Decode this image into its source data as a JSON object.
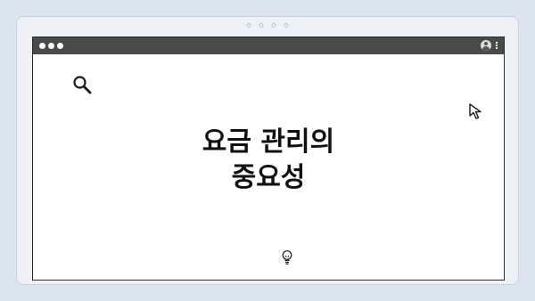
{
  "pager": {
    "dots": [
      "dot-1",
      "dot-2",
      "dot-3",
      "dot-4"
    ]
  },
  "window": {
    "titlebar": {
      "controls": [
        "close",
        "minimize",
        "maximize"
      ],
      "right_icons": [
        "user-icon",
        "kebab-menu-icon"
      ]
    }
  },
  "content": {
    "headline_line1": "요금 관리의",
    "headline_line2": "중요성",
    "icons": [
      "search-icon",
      "cursor-arrow-icon",
      "lightbulb-icon"
    ]
  },
  "colors": {
    "background": "#dde5ee",
    "device": "#eef2f6",
    "titlebar": "#4a4a4a",
    "window": "#ffffff",
    "text": "#111111"
  }
}
